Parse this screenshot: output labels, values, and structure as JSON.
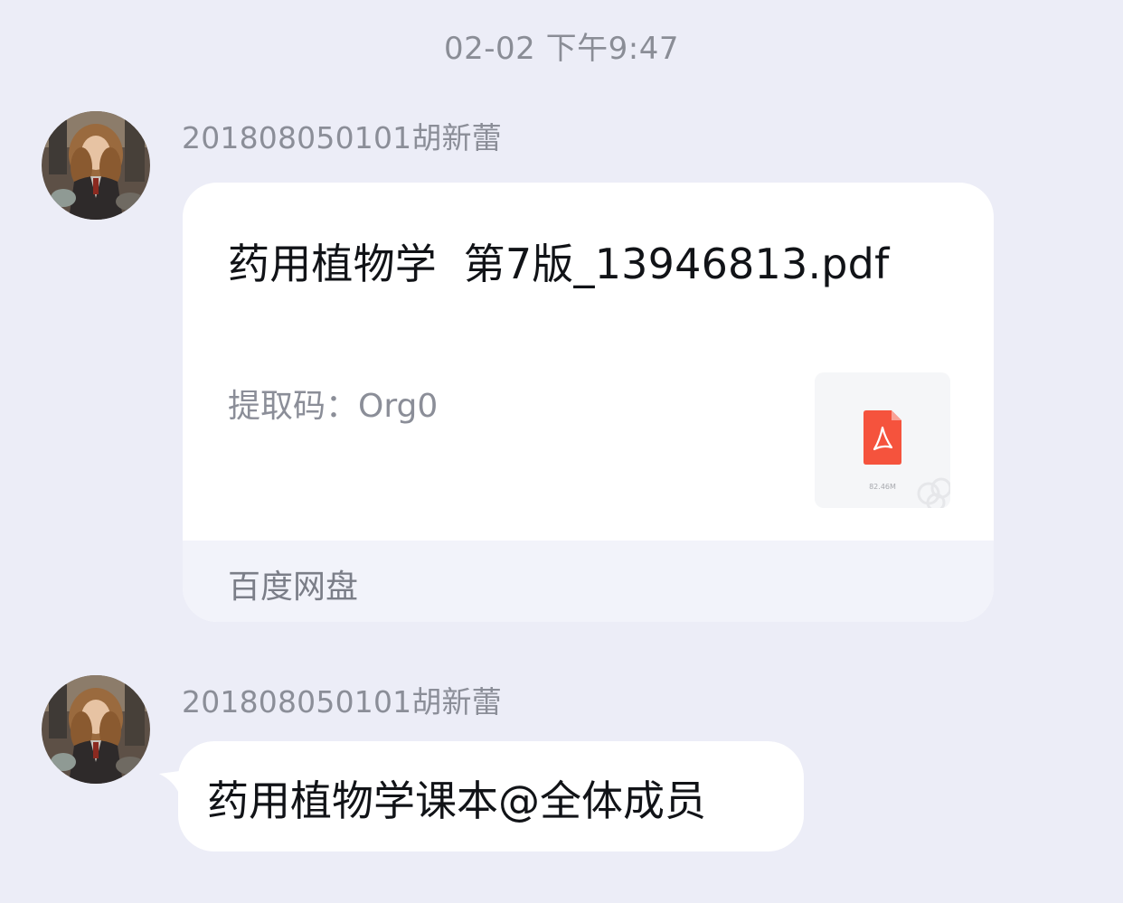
{
  "chat": {
    "timestamp": "02-02 下午9:47",
    "messages": [
      {
        "sender": "201808050101胡新蕾",
        "avatar": "user-avatar",
        "type": "share-card",
        "title": "药用植物学  第7版_13946813.pdf",
        "extract_code": "提取码：Org0",
        "file_icon": "pdf-file-icon",
        "file_size": "82.46M",
        "source": "百度网盘"
      },
      {
        "sender": "201808050101胡新蕾",
        "avatar": "user-avatar",
        "type": "text",
        "text": "药用植物学课本@全体成员"
      }
    ]
  },
  "colors": {
    "background": "#ecedf7",
    "bubble": "#ffffff",
    "card_footer": "#f2f3fa",
    "pdf_red": "#f5533d",
    "secondary_text": "#8b8e98",
    "primary_text": "#111317"
  }
}
